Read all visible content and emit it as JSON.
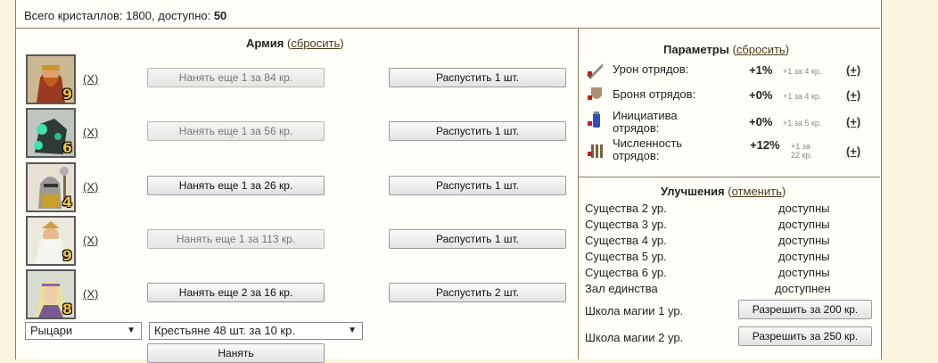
{
  "header": {
    "crystals_label": "Всего кристаллов: 1800, доступно: ",
    "available": "50"
  },
  "army": {
    "title": "Армия",
    "reset_open": "(",
    "reset_label": "сбросить",
    "reset_close": ")",
    "units": [
      {
        "level": "9",
        "x_label": "(X)",
        "hire_label": "Нанять еще 1 за 84 кр.",
        "hire_enabled": false,
        "dismiss_label": "Распустить 1 шт."
      },
      {
        "level": "6",
        "x_label": "(X)",
        "hire_label": "Нанять еще 1 за 56 кр.",
        "hire_enabled": false,
        "dismiss_label": "Распустить 1 шт."
      },
      {
        "level": "4",
        "x_label": "(X)",
        "hire_label": "Нанять еще 1 за 26 кр.",
        "hire_enabled": true,
        "dismiss_label": "Распустить 1 шт."
      },
      {
        "level": "9",
        "x_label": "(X)",
        "hire_label": "Нанять еще 1 за 113 кр.",
        "hire_enabled": false,
        "dismiss_label": "Распустить 1 шт."
      },
      {
        "level": "8",
        "x_label": "(X)",
        "hire_label": "Нанять еще 2 за 16 кр.",
        "hire_enabled": true,
        "dismiss_label": "Распустить 2 шт."
      }
    ],
    "faction_select": "Рыцари",
    "unit_select": "Крестьяне 48 шт. за 10 кр.",
    "hire_button": "Нанять"
  },
  "params": {
    "title": "Параметры",
    "reset_open": "(",
    "reset_label": "сбросить",
    "reset_close": ")",
    "rows": [
      {
        "label": "Урон отрядов:",
        "value": "+1%",
        "note": "+1 за 4 кр.",
        "plus": "(+)",
        "icon": "sword-icon"
      },
      {
        "label": "Броня отрядов:",
        "value": "+0%",
        "note": "+1 за 4 кр.",
        "plus": "(+)",
        "icon": "shield-icon"
      },
      {
        "label": "Инициатива отрядов:",
        "value": "+0%",
        "note": "+1 за 5 кр.",
        "plus": "(+)",
        "icon": "potion-icon"
      },
      {
        "label": "Численность отрядов:",
        "value": "+12%",
        "note": "+1 за 22 кр.",
        "plus": "(+)",
        "icon": "troops-icon"
      }
    ]
  },
  "upgrades": {
    "title": "Улучшения",
    "cancel_open": "(",
    "cancel_label": "отменить",
    "cancel_close": ")",
    "rows": [
      {
        "label": "Существа 2 ур.",
        "status": "доступны"
      },
      {
        "label": "Существа 3 ур.",
        "status": "доступны"
      },
      {
        "label": "Существа 4 ур.",
        "status": "доступны"
      },
      {
        "label": "Существа 5 ур.",
        "status": "доступны"
      },
      {
        "label": "Существа 6 ур.",
        "status": "доступны"
      },
      {
        "label": "Зал единства",
        "status": "доступнен"
      }
    ],
    "schools": [
      {
        "label": "Школа магии 1 ур.",
        "button": "Разрешить за 200 кр."
      },
      {
        "label": "Школа магии 2 ур.",
        "button": "Разрешить за 250 кр."
      }
    ]
  }
}
